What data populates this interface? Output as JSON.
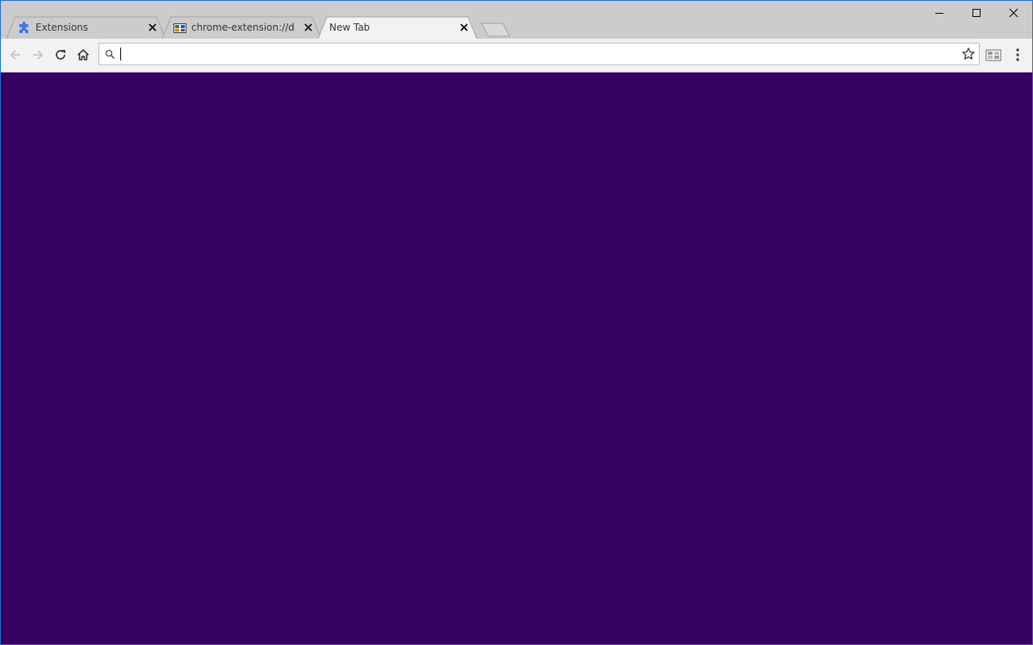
{
  "browser": {
    "colors": {
      "tabstrip": "#cccccc",
      "active_tab": "#f2f2f2",
      "toolbar": "#f2f2f2",
      "page_background": "#360060",
      "window_border": "#1e6fd1",
      "extension_icon_blue": "#3b78e7"
    },
    "tabs": [
      {
        "title": "Extensions",
        "icon": "puzzle-icon",
        "active": false
      },
      {
        "title": "chrome-extension://dmkl",
        "icon": "extension-page-icon",
        "active": false
      },
      {
        "title": "New Tab",
        "icon": "",
        "active": true
      }
    ],
    "window_controls": [
      "minimize-icon",
      "maximize-icon",
      "close-icon"
    ],
    "toolbar": {
      "buttons": [
        "back-arrow-icon",
        "forward-arrow-icon",
        "reload-icon",
        "home-icon"
      ],
      "omnibox": {
        "value": "",
        "icon": "search-icon",
        "bookmark_icon": "star-icon"
      },
      "extension_icon": "extension-grid-icon",
      "menu_icon": "kebab-menu-icon"
    }
  }
}
